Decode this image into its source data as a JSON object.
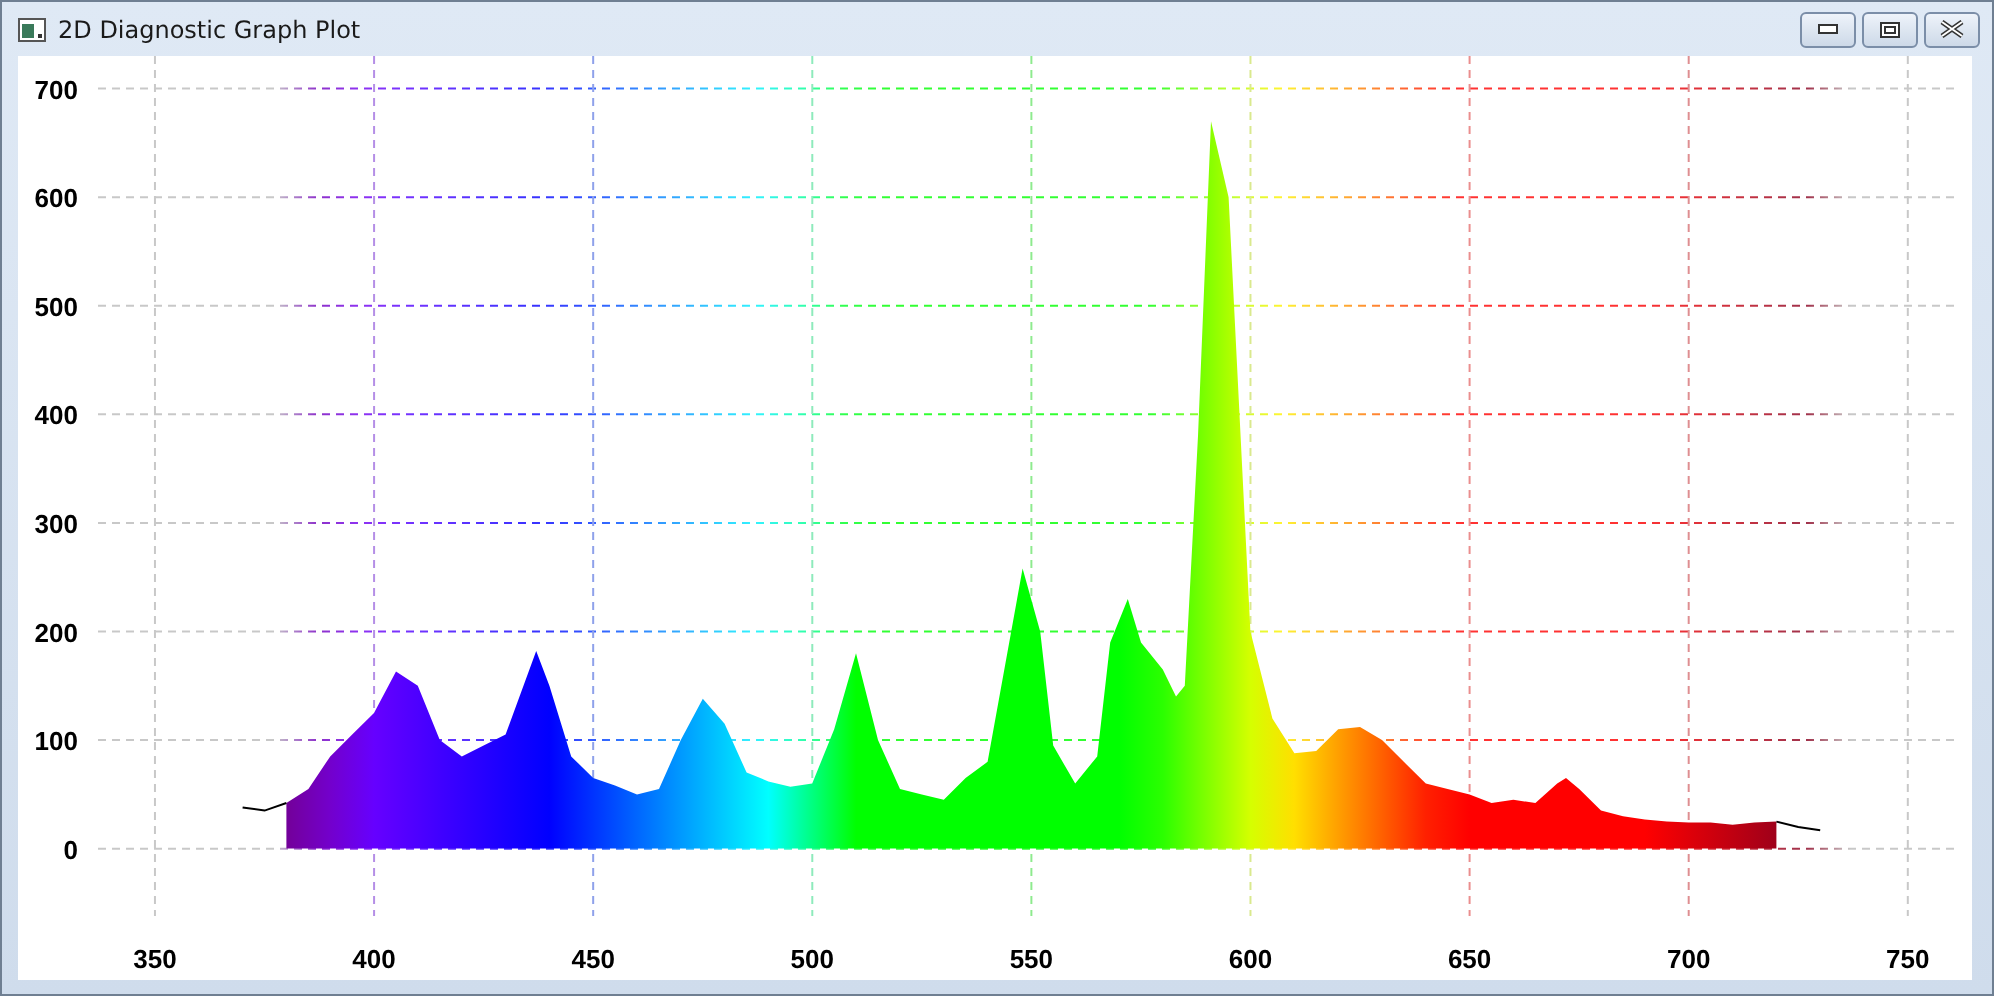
{
  "window": {
    "title": "2D Diagnostic Graph Plot"
  },
  "chart_data": {
    "type": "area",
    "xlim": [
      337,
      761
    ],
    "ylim": [
      -62,
      730
    ],
    "grid": true,
    "xticks": [
      350,
      400,
      450,
      500,
      550,
      600,
      650,
      700,
      750
    ],
    "yticks": [
      0,
      100,
      200,
      300,
      400,
      500,
      600,
      700
    ],
    "x": [
      370,
      375,
      380,
      385,
      390,
      395,
      400,
      405,
      410,
      415,
      420,
      425,
      430,
      437,
      440,
      445,
      450,
      455,
      460,
      465,
      470,
      475,
      480,
      485,
      490,
      495,
      500,
      505,
      510,
      515,
      520,
      525,
      530,
      535,
      540,
      548,
      552,
      555,
      560,
      565,
      568,
      572,
      575,
      580,
      583,
      585,
      588,
      591,
      595,
      600,
      605,
      610,
      615,
      620,
      625,
      630,
      635,
      640,
      645,
      650,
      655,
      660,
      665,
      670,
      672,
      675,
      680,
      685,
      690,
      695,
      700,
      705,
      710,
      715,
      720,
      725,
      730
    ],
    "series": [
      {
        "values": [
          null,
          null,
          42,
          55,
          85,
          105,
          125,
          163,
          150,
          100,
          85,
          95,
          105,
          182,
          150,
          85,
          65,
          58,
          50,
          55,
          100,
          138,
          115,
          70,
          62,
          57,
          60,
          110,
          180,
          100,
          55,
          50,
          45,
          65,
          80,
          258,
          200,
          95,
          60,
          85,
          190,
          230,
          190,
          165,
          140,
          150,
          380,
          670,
          600,
          200,
          120,
          88,
          90,
          110,
          112,
          100,
          80,
          60,
          55,
          50,
          42,
          45,
          42,
          60,
          65,
          55,
          35,
          30,
          27,
          25,
          24,
          24,
          22,
          24,
          25,
          null,
          null
        ]
      },
      {
        "type": "line",
        "color": "#000000",
        "values": [
          38,
          35,
          42,
          null,
          null,
          null,
          null,
          null,
          null,
          null,
          null,
          null,
          null,
          null,
          null,
          null,
          null,
          null,
          null,
          null,
          null,
          null,
          null,
          null,
          null,
          null,
          null,
          null,
          null,
          null,
          null,
          null,
          null,
          null,
          null,
          null,
          null,
          null,
          null,
          null,
          null,
          null,
          null,
          null,
          null,
          null,
          null,
          null,
          null,
          null,
          null,
          null,
          null,
          null,
          null,
          null,
          null,
          null,
          null,
          null,
          null,
          null,
          null,
          null,
          null,
          null,
          null,
          null,
          null,
          null,
          null,
          null,
          null,
          null,
          25,
          20,
          17
        ]
      }
    ]
  }
}
